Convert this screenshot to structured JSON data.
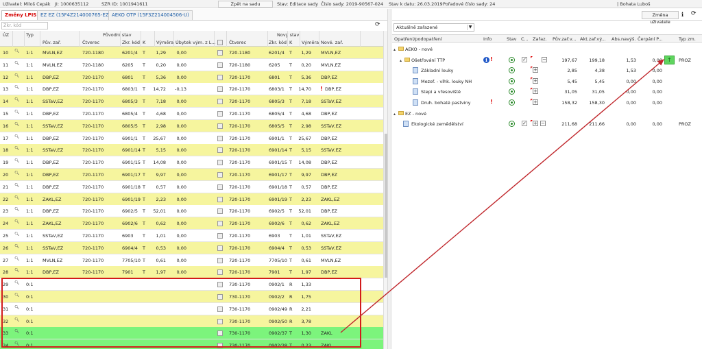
{
  "topbar": {
    "user": "Uživatel: Miloš Cepák",
    "ji": "JI: 1000635112",
    "szr": "SZR ID: 1001941611",
    "back_button": "Zpět na sadu",
    "state": "Stav: Editace sady",
    "set_number": "Číslo sady: 2019-90567-024",
    "state_date": "Stav k datu: 26.03.2019",
    "order": "Pořadové číslo sady: 24",
    "person": "| Bohata Luboš"
  },
  "tabs": [
    {
      "label": "Změny LPIS"
    },
    {
      "label": "EZ EZ (15F4Z214000765-EZ)"
    },
    {
      "label": "AEKO OTP (15F3Z214004506-U)"
    }
  ],
  "filter_placeholder": "Zkr. kód",
  "left_headers": {
    "uz": "ÚZ",
    "typ": "Typ",
    "orig_group": "Původní stav",
    "new_group": "Nový stav",
    "puv_zar": "Pův. zař.",
    "ctverec": "Čtverec",
    "zkr_kod": "Zkr. kód",
    "k": "K",
    "vymera": "Výměra",
    "ubytek": "Úbytek vým. z L...",
    "ctverec2": "Čtverec",
    "zkr_kod2": "Zkr. kód",
    "k2": "K",
    "vymera2": "Výměra",
    "nove_zar": "Nové. zař."
  },
  "rows": [
    {
      "uz": "10",
      "typ": "1:1",
      "puv": "MVLN,EZ",
      "ctv": "720-1180",
      "kod": "6201/4",
      "k": "T",
      "vym": "1,29",
      "ub": "0,00",
      "ctv2": "720-1180",
      "kod2": "6201/4",
      "k2": "T",
      "vym2": "1,29",
      "nove": "MVLN,EZ",
      "bg": "y",
      "bang": false
    },
    {
      "uz": "11",
      "typ": "1:1",
      "puv": "MVLN,EZ",
      "ctv": "720-1180",
      "kod": "6205",
      "k": "T",
      "vym": "0,20",
      "ub": "0,00",
      "ctv2": "720-1180",
      "kod2": "6205",
      "k2": "T",
      "vym2": "0,20",
      "nove": "MVLN,EZ",
      "bg": "w",
      "bang": false
    },
    {
      "uz": "12",
      "typ": "1:1",
      "puv": "DBP,EZ",
      "ctv": "720-1170",
      "kod": "6801",
      "k": "T",
      "vym": "5,36",
      "ub": "0,00",
      "ctv2": "720-1170",
      "kod2": "6801",
      "k2": "T",
      "vym2": "5,36",
      "nove": "DBP,EZ",
      "bg": "y",
      "bang": false
    },
    {
      "uz": "13",
      "typ": "1:1",
      "puv": "DBP,EZ",
      "ctv": "720-1170",
      "kod": "6803/1",
      "k": "T",
      "vym": "14,72",
      "ub": "-0,13",
      "ctv2": "720-1170",
      "kod2": "6803/1",
      "k2": "T",
      "vym2": "14,70",
      "nove": "DBP,EZ",
      "bg": "w",
      "bang": true
    },
    {
      "uz": "14",
      "typ": "1:1",
      "puv": "SSTaV,EZ",
      "ctv": "720-1170",
      "kod": "6805/3",
      "k": "T",
      "vym": "7,18",
      "ub": "0,00",
      "ctv2": "720-1170",
      "kod2": "6805/3",
      "k2": "T",
      "vym2": "7,18",
      "nove": "SSTaV,EZ",
      "bg": "y",
      "bang": false
    },
    {
      "uz": "15",
      "typ": "1:1",
      "puv": "DBP,EZ",
      "ctv": "720-1170",
      "kod": "6805/4",
      "k": "T",
      "vym": "4,68",
      "ub": "0,00",
      "ctv2": "720-1170",
      "kod2": "6805/4",
      "k2": "T",
      "vym2": "4,68",
      "nove": "DBP,EZ",
      "bg": "w",
      "bang": false
    },
    {
      "uz": "16",
      "typ": "1:1",
      "puv": "SSTaV,EZ",
      "ctv": "720-1170",
      "kod": "6805/5",
      "k": "T",
      "vym": "2,98",
      "ub": "0,00",
      "ctv2": "720-1170",
      "kod2": "6805/5",
      "k2": "T",
      "vym2": "2,98",
      "nove": "SSTaV,EZ",
      "bg": "y",
      "bang": false
    },
    {
      "uz": "17",
      "typ": "1:1",
      "puv": "DBP,EZ",
      "ctv": "720-1170",
      "kod": "6901/1",
      "k": "T",
      "vym": "25,67",
      "ub": "0,00",
      "ctv2": "720-1170",
      "kod2": "6901/1",
      "k2": "T",
      "vym2": "25,67",
      "nove": "DBP,EZ",
      "bg": "w",
      "bang": false
    },
    {
      "uz": "18",
      "typ": "1:1",
      "puv": "SSTaV,EZ",
      "ctv": "720-1170",
      "kod": "6901/14",
      "k": "T",
      "vym": "5,15",
      "ub": "0,00",
      "ctv2": "720-1170",
      "kod2": "6901/14",
      "k2": "T",
      "vym2": "5,15",
      "nove": "SSTaV,EZ",
      "bg": "y",
      "bang": false
    },
    {
      "uz": "19",
      "typ": "1:1",
      "puv": "DBP,EZ",
      "ctv": "720-1170",
      "kod": "6901/15",
      "k": "T",
      "vym": "14,08",
      "ub": "0,00",
      "ctv2": "720-1170",
      "kod2": "6901/15",
      "k2": "T",
      "vym2": "14,08",
      "nove": "DBP,EZ",
      "bg": "w",
      "bang": false
    },
    {
      "uz": "20",
      "typ": "1:1",
      "puv": "DBP,EZ",
      "ctv": "720-1170",
      "kod": "6901/17",
      "k": "T",
      "vym": "9,97",
      "ub": "0,00",
      "ctv2": "720-1170",
      "kod2": "6901/17",
      "k2": "T",
      "vym2": "9,97",
      "nove": "DBP,EZ",
      "bg": "y",
      "bang": false
    },
    {
      "uz": "21",
      "typ": "1:1",
      "puv": "DBP,EZ",
      "ctv": "720-1170",
      "kod": "6901/18",
      "k": "T",
      "vym": "0,57",
      "ub": "0,00",
      "ctv2": "720-1170",
      "kod2": "6901/18",
      "k2": "T",
      "vym2": "0,57",
      "nove": "DBP,EZ",
      "bg": "w",
      "bang": false
    },
    {
      "uz": "22",
      "typ": "1:1",
      "puv": "ZAKL,EZ",
      "ctv": "720-1170",
      "kod": "6901/19",
      "k": "T",
      "vym": "2,23",
      "ub": "0,00",
      "ctv2": "720-1170",
      "kod2": "6901/19",
      "k2": "T",
      "vym2": "2,23",
      "nove": "ZAKL,EZ",
      "bg": "y",
      "bang": false
    },
    {
      "uz": "23",
      "typ": "1:1",
      "puv": "DBP,EZ",
      "ctv": "720-1170",
      "kod": "6902/5",
      "k": "T",
      "vym": "52,01",
      "ub": "0,00",
      "ctv2": "720-1170",
      "kod2": "6902/5",
      "k2": "T",
      "vym2": "52,01",
      "nove": "DBP,EZ",
      "bg": "w",
      "bang": false
    },
    {
      "uz": "24",
      "typ": "1:1",
      "puv": "ZAKL,EZ",
      "ctv": "720-1170",
      "kod": "6902/6",
      "k": "T",
      "vym": "0,62",
      "ub": "0,00",
      "ctv2": "720-1170",
      "kod2": "6902/6",
      "k2": "T",
      "vym2": "0,62",
      "nove": "ZAKL,EZ",
      "bg": "y",
      "bang": false
    },
    {
      "uz": "25",
      "typ": "1:1",
      "puv": "SSTaV,EZ",
      "ctv": "720-1170",
      "kod": "6903",
      "k": "T",
      "vym": "1,01",
      "ub": "0,00",
      "ctv2": "720-1170",
      "kod2": "6903",
      "k2": "T",
      "vym2": "1,01",
      "nove": "SSTaV,EZ",
      "bg": "w",
      "bang": false
    },
    {
      "uz": "26",
      "typ": "1:1",
      "puv": "SSTaV,EZ",
      "ctv": "720-1170",
      "kod": "6904/4",
      "k": "T",
      "vym": "0,53",
      "ub": "0,00",
      "ctv2": "720-1170",
      "kod2": "6904/4",
      "k2": "T",
      "vym2": "0,53",
      "nove": "SSTaV,EZ",
      "bg": "y",
      "bang": false
    },
    {
      "uz": "27",
      "typ": "1:1",
      "puv": "MVLN,EZ",
      "ctv": "720-1170",
      "kod": "7705/10",
      "k": "T",
      "vym": "0,61",
      "ub": "0,00",
      "ctv2": "720-1170",
      "kod2": "7705/10",
      "k2": "T",
      "vym2": "0,61",
      "nove": "MVLN,EZ",
      "bg": "w",
      "bang": false
    },
    {
      "uz": "28",
      "typ": "1:1",
      "puv": "DBP,EZ",
      "ctv": "720-1170",
      "kod": "7901",
      "k": "T",
      "vym": "1,97",
      "ub": "0,00",
      "ctv2": "720-1170",
      "kod2": "7901",
      "k2": "T",
      "vym2": "1,97",
      "nove": "DBP,EZ",
      "bg": "y",
      "bang": false
    },
    {
      "uz": "29",
      "typ": "0:1",
      "puv": "",
      "ctv": "",
      "kod": "",
      "k": "",
      "vym": "",
      "ub": "",
      "ctv2": "730-1170",
      "kod2": "0902/1",
      "k2": "R",
      "vym2": "1,33",
      "nove": "",
      "bg": "w",
      "bang": false
    },
    {
      "uz": "30",
      "typ": "0:1",
      "puv": "",
      "ctv": "",
      "kod": "",
      "k": "",
      "vym": "",
      "ub": "",
      "ctv2": "730-1170",
      "kod2": "0902/2",
      "k2": "R",
      "vym2": "1,75",
      "nove": "",
      "bg": "y",
      "bang": false
    },
    {
      "uz": "31",
      "typ": "0:1",
      "puv": "",
      "ctv": "",
      "kod": "",
      "k": "",
      "vym": "",
      "ub": "",
      "ctv2": "730-1170",
      "kod2": "0902/49",
      "k2": "R",
      "vym2": "2,21",
      "nove": "",
      "bg": "w",
      "bang": false
    },
    {
      "uz": "32",
      "typ": "0:1",
      "puv": "",
      "ctv": "",
      "kod": "",
      "k": "",
      "vym": "",
      "ub": "",
      "ctv2": "730-1170",
      "kod2": "0902/50",
      "k2": "R",
      "vym2": "3,78",
      "nove": "",
      "bg": "y",
      "bang": false
    },
    {
      "uz": "33",
      "typ": "0:1",
      "puv": "",
      "ctv": "",
      "kod": "",
      "k": "",
      "vym": "",
      "ub": "",
      "ctv2": "730-1170",
      "kod2": "0902/37",
      "k2": "T",
      "vym2": "1,30",
      "nove": "ZAKL",
      "bg": "g",
      "bang": false
    },
    {
      "uz": "34",
      "typ": "0:1",
      "puv": "",
      "ctv": "",
      "kod": "",
      "k": "",
      "vym": "",
      "ub": "",
      "ctv2": "730-1170",
      "kod2": "0902/38",
      "k2": "T",
      "vym2": "0,23",
      "nove": "ZAKL",
      "bg": "g",
      "bang": false
    }
  ],
  "right": {
    "user_button": "Změna uživatele",
    "select_value": "Aktuálně zařazené",
    "headers": {
      "opatreni": "Opatření/podopatření",
      "info": "Info",
      "stav": "Stav",
      "c": "C...",
      "zaraz": "Zařaz.",
      "puv": "Pův.zař.v...",
      "akt": "Akt.zař.vý...",
      "abs": "Abs.navýš.",
      "cerpani": "Čerpání P...",
      "typ": "Typ zm."
    },
    "tree": [
      {
        "label": "AEKO - nové",
        "level": 0,
        "kind": "group"
      },
      {
        "label": "Ošetřování TTP",
        "level": 1,
        "kind": "folder",
        "info": true,
        "bang": true,
        "stav": true,
        "check": true,
        "minus": true,
        "puv": "197,67",
        "akt": "199,18",
        "abs": "1,53",
        "cerp": "0,00",
        "typ": "PROZ",
        "up": true
      },
      {
        "label": "Základní louky",
        "level": 2,
        "kind": "doc",
        "stav": true,
        "plus": true,
        "puv": "2,85",
        "akt": "4,38",
        "abs": "1,53",
        "cerp": "0,00"
      },
      {
        "label": "Mezof. - vlhk. louky NH",
        "level": 2,
        "kind": "doc",
        "stav": true,
        "plus": true,
        "puv": "5,45",
        "akt": "5,45",
        "abs": "0,00",
        "cerp": "0,00"
      },
      {
        "label": "Stepi a vřesoviště",
        "level": 2,
        "kind": "doc",
        "stav": true,
        "plus": true,
        "puv": "31,05",
        "akt": "31,05",
        "abs": "0,00",
        "cerp": "0,00"
      },
      {
        "label": "Druh. bohaté pastviny",
        "level": 2,
        "kind": "doc",
        "bang": true,
        "stav": true,
        "plus": true,
        "puv": "158,32",
        "akt": "158,30",
        "abs": "0,00",
        "cerp": "0,00"
      },
      {
        "label": "EZ - nové",
        "level": 0,
        "kind": "group"
      },
      {
        "label": "Ekologické zemědělství",
        "level": 1,
        "kind": "doc",
        "stav": true,
        "check": true,
        "plus": true,
        "minus": true,
        "puv": "211,68",
        "akt": "211,66",
        "abs": "0,00",
        "cerp": "0,00",
        "typ": "PROZ"
      }
    ]
  },
  "colors": {
    "yellow": "#f6f59e",
    "green": "#7cf47c",
    "red_box": "#d21b1b",
    "arrow": "#c0282d"
  }
}
